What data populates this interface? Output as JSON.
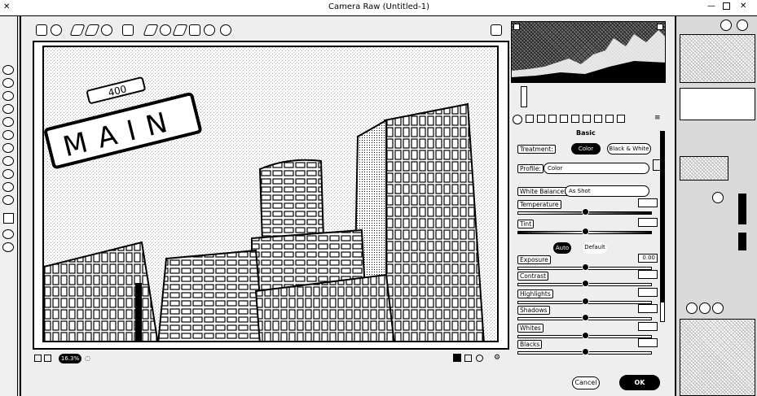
{
  "window": {
    "title": "Camera Raw (Untitled-1)"
  },
  "toolbar": {
    "tools": [
      "zoom-tool",
      "hand-tool",
      "white-balance-tool",
      "color-sampler-tool",
      "targeted-adjustment-tool",
      "crop-tool",
      "straighten-tool",
      "spot-removal-tool",
      "red-eye-tool",
      "adjustment-brush-tool",
      "graduated-filter-tool",
      "radial-filter-tool",
      "fullscreen-tool"
    ]
  },
  "preview": {
    "sign_number": "400",
    "sign_text": "MAIN"
  },
  "status": {
    "zoom": "16.3%"
  },
  "panel": {
    "title": "Basic",
    "treatment_label": "Treatment:",
    "color_option": "Color",
    "bw_option": "Black & White",
    "profile_label": "Profile:",
    "profile_value": "Color",
    "wb_label": "White Balance:",
    "wb_value": "As Shot",
    "temperature_label": "Temperature",
    "tint_label": "Tint",
    "auto_label": "Auto",
    "default_label": "Default",
    "exposure_label": "Exposure",
    "exposure_value": "0.00",
    "contrast_label": "Contrast",
    "highlights_label": "Highlights",
    "shadows_label": "Shadows",
    "whites_label": "Whites",
    "blacks_label": "Blacks"
  },
  "footer": {
    "cancel_label": "Cancel",
    "ok_label": "OK"
  },
  "colors": {
    "ink": "#000000",
    "paper": "#ffffff",
    "chrome": "#eeeeee"
  }
}
